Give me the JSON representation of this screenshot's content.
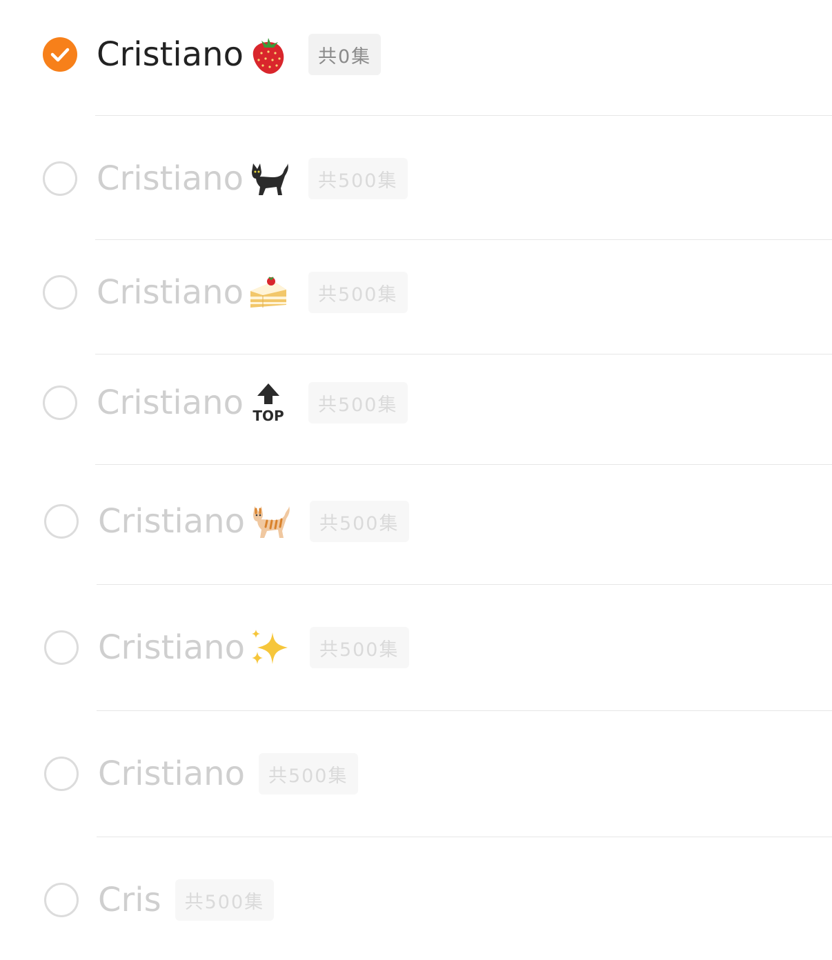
{
  "items": [
    {
      "name": "Cristiano",
      "emoji": "strawberry-icon",
      "badge": "共0集",
      "selected": true
    },
    {
      "name": "Cristiano",
      "emoji": "black-cat-icon",
      "badge": "共500集",
      "selected": false
    },
    {
      "name": "Cristiano",
      "emoji": "shortcake-icon",
      "badge": "共500集",
      "selected": false
    },
    {
      "name": "Cristiano",
      "emoji": "top-arrow-icon",
      "badge": "共500集",
      "selected": false
    },
    {
      "name": "Cristiano",
      "emoji": "tabby-cat-icon",
      "badge": "共500集",
      "selected": false
    },
    {
      "name": "Cristiano",
      "emoji": "sparkles-icon",
      "badge": "共500集",
      "selected": false
    },
    {
      "name": "Cristiano",
      "emoji": "",
      "badge": "共500集",
      "selected": false
    },
    {
      "name": "Cris",
      "emoji": "",
      "badge": "共500集",
      "selected": false
    }
  ],
  "colors": {
    "accent": "#f7801a",
    "selected_text": "#222222",
    "unselected_text": "#cfcfcf",
    "divider": "#e6e6e6"
  }
}
